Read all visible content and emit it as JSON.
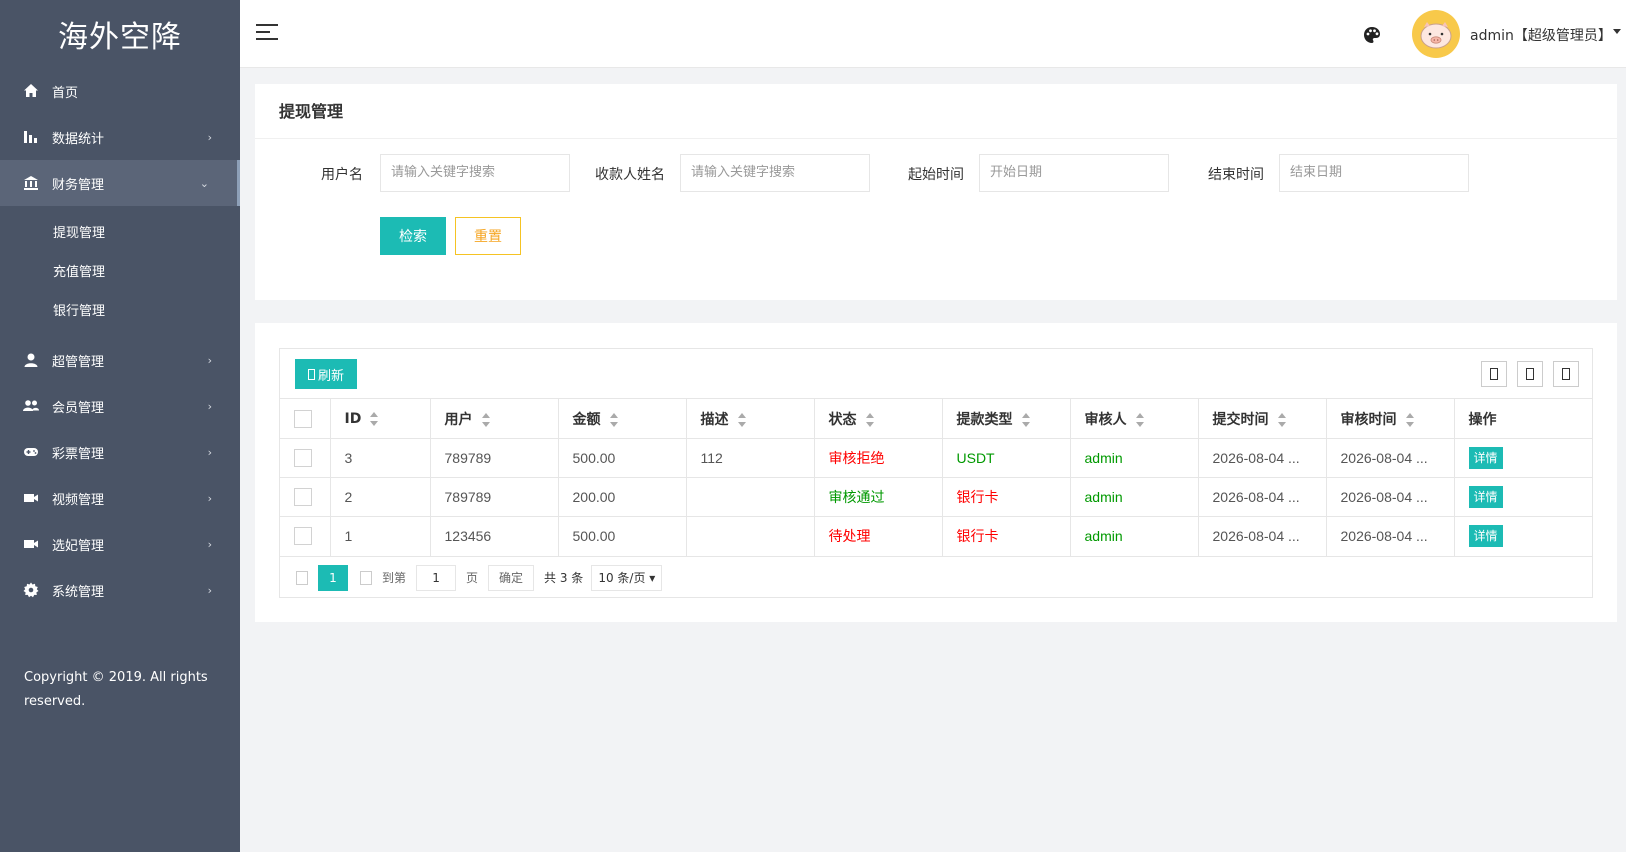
{
  "app": {
    "logo": "海外空降"
  },
  "sidebar": {
    "items": [
      {
        "label": "首页",
        "icon": "home-icon",
        "has_children": false
      },
      {
        "label": "数据统计",
        "icon": "bar-chart-icon",
        "has_children": true
      },
      {
        "label": "财务管理",
        "icon": "bank-icon",
        "has_children": true,
        "expanded": true,
        "children": [
          "提现管理",
          "充值管理",
          "银行管理"
        ]
      },
      {
        "label": "超管管理",
        "icon": "user-icon",
        "has_children": true
      },
      {
        "label": "会员管理",
        "icon": "users-icon",
        "has_children": true
      },
      {
        "label": "彩票管理",
        "icon": "gamepad-icon",
        "has_children": true
      },
      {
        "label": "视频管理",
        "icon": "video-camera-icon",
        "has_children": true
      },
      {
        "label": "选妃管理",
        "icon": "video-camera-icon",
        "has_children": true
      },
      {
        "label": "系统管理",
        "icon": "gear-icon",
        "has_children": true
      }
    ],
    "copyright": "Copyright © 2019. All rights reserved."
  },
  "header": {
    "user_label": "admin【超级管理员】"
  },
  "search": {
    "title": "提现管理",
    "fields": [
      {
        "label": "用户名",
        "placeholder": "请输入关键字搜索"
      },
      {
        "label": "收款人姓名",
        "placeholder": "请输入关键字搜索"
      },
      {
        "label": "起始时间",
        "placeholder": "开始日期"
      },
      {
        "label": "结束时间",
        "placeholder": "结束日期"
      }
    ],
    "search_label": "检索",
    "reset_label": "重置"
  },
  "table": {
    "refresh_label": "刷新",
    "columns": [
      "ID",
      "用户",
      "金额",
      "描述",
      "状态",
      "提款类型",
      "审核人",
      "提交时间",
      "审核时间",
      "操作"
    ],
    "rows": [
      {
        "id": "3",
        "user": "789789",
        "amount": "500.00",
        "desc": "112",
        "status": "审核拒绝",
        "status_color": "#ff0000",
        "type": "USDT",
        "type_color": "#009900",
        "reviewer": "admin",
        "submit_time": "2026-08-04 ...",
        "review_time": "2026-08-04 ...",
        "action": "详情"
      },
      {
        "id": "2",
        "user": "789789",
        "amount": "200.00",
        "desc": "",
        "status": "审核通过",
        "status_color": "#009900",
        "type": "银行卡",
        "type_color": "#ff0000",
        "reviewer": "admin",
        "submit_time": "2026-08-04 ...",
        "review_time": "2026-08-04 ...",
        "action": "详情"
      },
      {
        "id": "1",
        "user": "123456",
        "amount": "500.00",
        "desc": "",
        "status": "待处理",
        "status_color": "#ff0000",
        "type": "银行卡",
        "type_color": "#ff0000",
        "reviewer": "admin",
        "submit_time": "2026-08-04 ...",
        "review_time": "2026-08-04 ...",
        "action": "详情"
      }
    ]
  },
  "pager": {
    "current": "1",
    "goto_label": "到第",
    "goto_value": "1",
    "page_label": "页",
    "confirm_label": "确定",
    "total_label": "共 3 条",
    "page_size": "10 条/页"
  }
}
